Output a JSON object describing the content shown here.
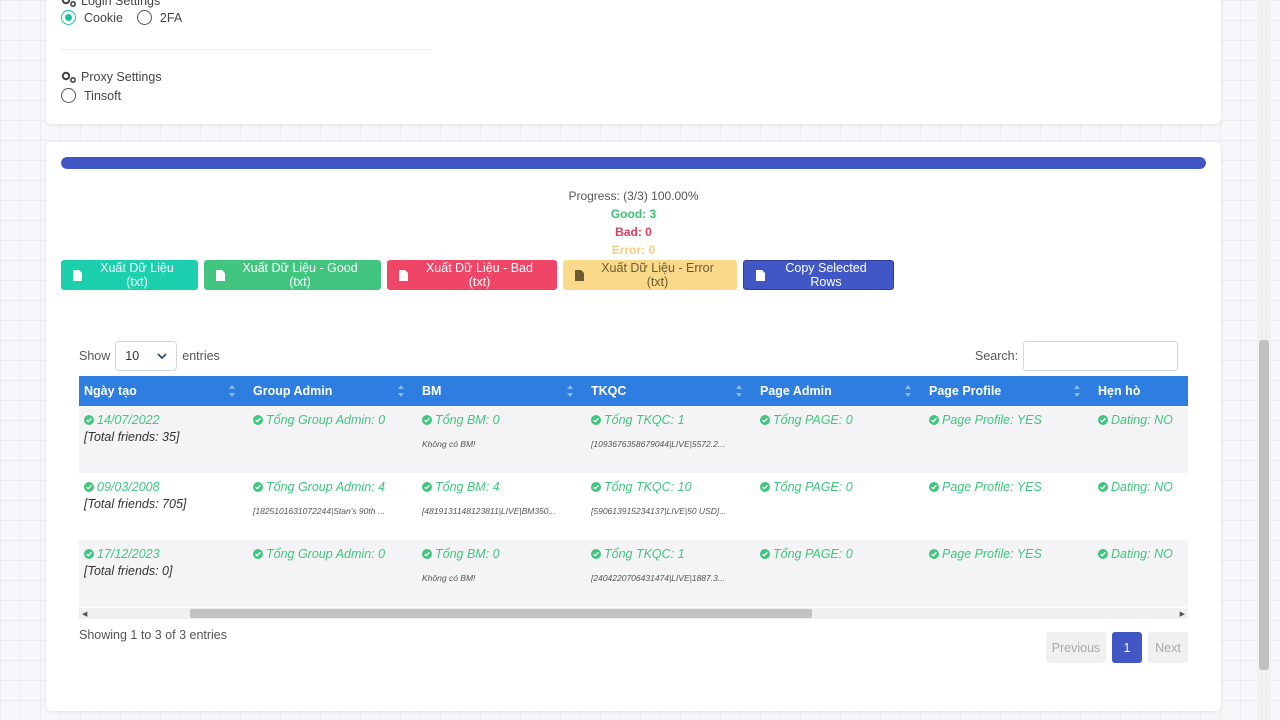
{
  "login": {
    "title": "Login Settings",
    "options": [
      {
        "label": "Cookie",
        "checked": true
      },
      {
        "label": "2FA",
        "checked": false
      }
    ]
  },
  "proxy": {
    "title": "Proxy Settings",
    "options": [
      {
        "label": "Tinsoft",
        "checked": false
      }
    ]
  },
  "progress": {
    "percent": 100,
    "text": "Progress: (3/3) 100.00%",
    "good": "Good: 3",
    "bad": "Bad: 0",
    "error": "Error: 0"
  },
  "buttons": {
    "export_all": "Xuất Dữ Liệu (txt)",
    "export_good": "Xuất Dữ Liệu - Good (txt)",
    "export_bad": "Xuất Dữ Liệu - Bad (txt)",
    "export_error": "Xuất Dữ Liệu - Error (txt)",
    "copy_selected": "Copy Selected Rows"
  },
  "table_controls": {
    "show_label": "Show",
    "entries_value": "10",
    "entries_label": "entries",
    "search_label": "Search:",
    "search_value": ""
  },
  "table": {
    "columns": [
      "Ngày tạo",
      "Group Admin",
      "BM",
      "TKQC",
      "Page Admin",
      "Page Profile",
      "Hẹn hò"
    ],
    "rows": [
      {
        "date": "14/07/2022",
        "friends": "[Total friends: 35]",
        "group": "Tổng Group Admin: 0",
        "group_detail": "",
        "bm": "Tổng BM: 0",
        "bm_detail": "Không có BM!",
        "tkqc": "Tổng TKQC: 1",
        "tkqc_detail": "[1093676358679044|LIVE|5572.2...",
        "page": "Tổng PAGE: 0",
        "profile": "Page Profile: YES",
        "dating": "Dating: NO"
      },
      {
        "date": "09/03/2008",
        "friends": "[Total friends: 705]",
        "group": "Tổng Group Admin: 4",
        "group_detail": "[1825101631072244|Stan's 90th ...",
        "bm": "Tổng BM: 4",
        "bm_detail": "[4819131148123811|LIVE|BM350...",
        "tkqc": "Tổng TKQC: 10",
        "tkqc_detail": "[590613915234137|LIVE|50 USD]...",
        "page": "Tổng PAGE: 0",
        "profile": "Page Profile: YES",
        "dating": "Dating: NO"
      },
      {
        "date": "17/12/2023",
        "friends": "[Total friends: 0]",
        "group": "Tổng Group Admin: 0",
        "group_detail": "",
        "bm": "Tổng BM: 0",
        "bm_detail": "Không có BM!",
        "tkqc": "Tổng TKQC: 1",
        "tkqc_detail": "[2404220706431474|LIVE|1887.3...",
        "page": "Tổng PAGE: 0",
        "profile": "Page Profile: YES",
        "dating": "Dating: NO"
      }
    ]
  },
  "footer": {
    "info": "Showing 1 to 3 of 3 entries",
    "previous": "Previous",
    "page": "1",
    "next": "Next"
  },
  "colors": {
    "accent_blue": "#4257c6",
    "header_blue": "#2d7ee0",
    "good_green": "#41c57f",
    "bad_red": "#ef4566",
    "error_yellow": "#fad98a",
    "teal": "#1ccfad"
  }
}
